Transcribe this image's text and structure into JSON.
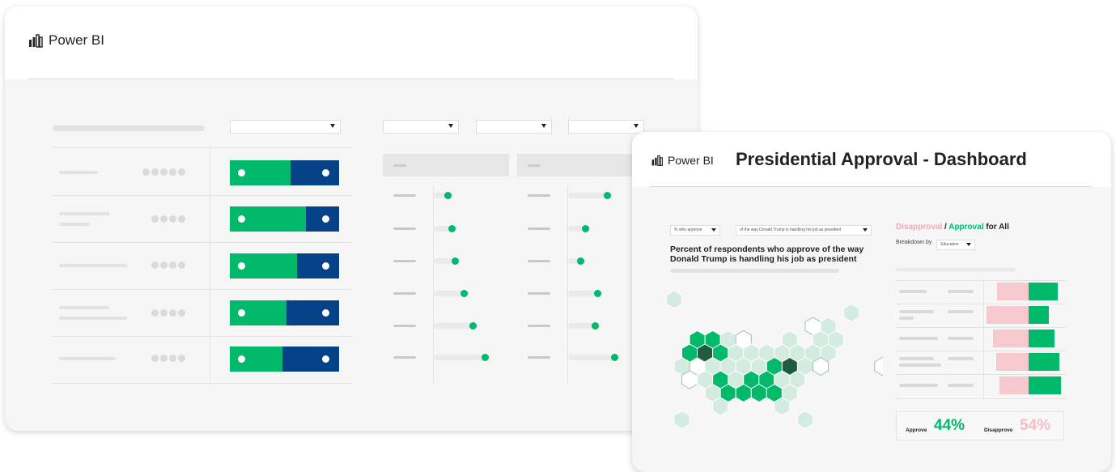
{
  "left_card": {
    "logo_text": "Power BI"
  },
  "right_card": {
    "logo_text": "Power BI",
    "title": "Presidential Approval - Dashboard",
    "filter1": "% who approve",
    "filter2": "of the way Donald Trump is handling his job as president",
    "chart_title": "Percent of respondents who approve of the way Donald Trump is handling his job as president",
    "disapproval_label": "Disapproval",
    "slash": " / ",
    "approval_label": "Approval",
    "for_all": " for All",
    "breakdown_label": "Breakdown by",
    "breakdown_value": "Education",
    "approve_label": "Approve",
    "approve_value": "44%",
    "disapprove_label": "Disapprove",
    "disapprove_value": "54%"
  },
  "colors": {
    "green": "#00b96b",
    "navy": "#054288",
    "pink": "#f6c9cf",
    "light_green": "#cfe8dc",
    "dark_green": "#1f5c3f"
  }
}
